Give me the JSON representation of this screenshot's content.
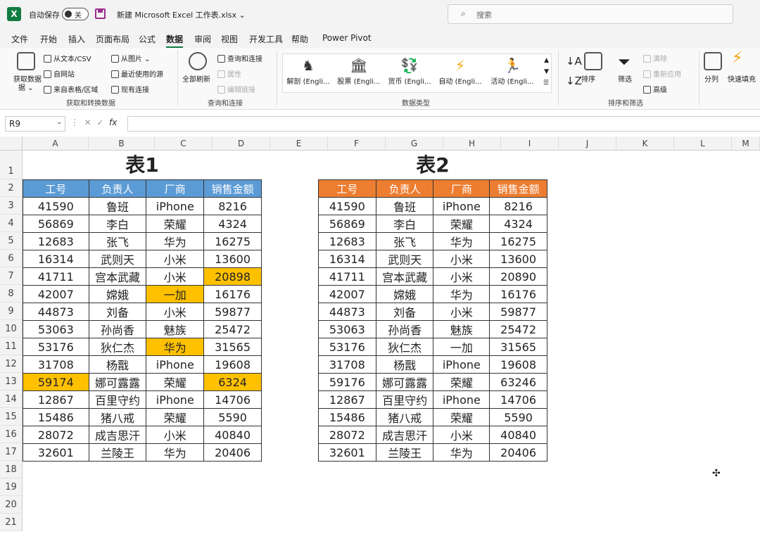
{
  "titlebar": {
    "autosave_label": "自动保存",
    "autosave_state": "关",
    "filename": "新建 Microsoft Excel 工作表.xlsx ⌄",
    "search_placeholder": "搜索"
  },
  "menu": [
    "文件",
    "开始",
    "插入",
    "页面布局",
    "公式",
    "数据",
    "审阅",
    "视图",
    "开发工具",
    "帮助",
    "Power Pivot"
  ],
  "menu_active": "数据",
  "ribbon": {
    "get_data": "获取数据",
    "get_data_sub": "据 ⌄",
    "from_text_csv": "从文本/CSV",
    "from_web": "自网站",
    "from_table": "来自表格/区域",
    "from_picture": "从图片 ⌄",
    "recent_sources": "最近使用的源",
    "existing_conn": "现有连接",
    "group_get_transform": "获取和转换数据",
    "refresh_all": "全部刷新",
    "queries_conn": "查询和连接",
    "properties": "属性",
    "edit_links": "编辑链接",
    "group_queries": "查询和连接",
    "data_types": [
      {
        "label": "解剖 (Engli...",
        "icon": "anatomy-icon"
      },
      {
        "label": "股票 (Engli...",
        "icon": "stocks-icon"
      },
      {
        "label": "货币 (Engli...",
        "icon": "currency-icon"
      },
      {
        "label": "自动 (Engli...",
        "icon": "bolt-icon"
      },
      {
        "label": "活动 (Engli...",
        "icon": "activity-icon"
      }
    ],
    "group_data_types": "数据类型",
    "sort": "排序",
    "filter": "筛选",
    "clear": "清除",
    "reapply": "重新应用",
    "advanced": "高级",
    "group_sort_filter": "排序和筛选",
    "split": "分列",
    "flash_fill": "快速填充"
  },
  "formula_bar": {
    "name_box": "R9",
    "fx": "fx",
    "content": ""
  },
  "columns": [
    "A",
    "B",
    "C",
    "D",
    "E",
    "F",
    "G",
    "H",
    "I",
    "J",
    "K",
    "L",
    "M"
  ],
  "rows": [
    "1",
    "2",
    "3",
    "4",
    "5",
    "6",
    "7",
    "8",
    "9",
    "10",
    "11",
    "12",
    "13",
    "14",
    "15",
    "16",
    "17",
    "18",
    "19",
    "20",
    "21"
  ],
  "table1": {
    "title": "表1",
    "header": [
      "工号",
      "负责人",
      "厂商",
      "销售金额"
    ],
    "rows": [
      [
        "41590",
        "鲁班",
        "iPhone",
        "8216"
      ],
      [
        "56869",
        "李白",
        "荣耀",
        "4324"
      ],
      [
        "12683",
        "张飞",
        "华为",
        "16275"
      ],
      [
        "16314",
        "武则天",
        "小米",
        "13600"
      ],
      [
        "41711",
        "宫本武藏",
        "小米",
        "20898"
      ],
      [
        "42007",
        "嫦娥",
        "一加",
        "16176"
      ],
      [
        "44873",
        "刘备",
        "小米",
        "59877"
      ],
      [
        "53063",
        "孙尚香",
        "魅族",
        "25472"
      ],
      [
        "53176",
        "狄仁杰",
        "华为",
        "31565"
      ],
      [
        "31708",
        "杨戬",
        "iPhone",
        "19608"
      ],
      [
        "59174",
        "娜可露露",
        "荣耀",
        "6324"
      ],
      [
        "12867",
        "百里守约",
        "iPhone",
        "14706"
      ],
      [
        "15486",
        "猪八戒",
        "荣耀",
        "5590"
      ],
      [
        "28072",
        "成吉思汗",
        "小米",
        "40840"
      ],
      [
        "32601",
        "兰陵王",
        "华为",
        "20406"
      ]
    ],
    "highlight_color": "#ffc000",
    "highlights": [
      [
        4,
        3
      ],
      [
        5,
        2
      ],
      [
        8,
        2
      ],
      [
        10,
        0
      ],
      [
        10,
        3
      ]
    ]
  },
  "table2": {
    "title": "表2",
    "header": [
      "工号",
      "负责人",
      "厂商",
      "销售金额"
    ],
    "rows": [
      [
        "41590",
        "鲁班",
        "iPhone",
        "8216"
      ],
      [
        "56869",
        "李白",
        "荣耀",
        "4324"
      ],
      [
        "12683",
        "张飞",
        "华为",
        "16275"
      ],
      [
        "16314",
        "武则天",
        "小米",
        "13600"
      ],
      [
        "41711",
        "宫本武藏",
        "小米",
        "20890"
      ],
      [
        "42007",
        "嫦娥",
        "华为",
        "16176"
      ],
      [
        "44873",
        "刘备",
        "小米",
        "59877"
      ],
      [
        "53063",
        "孙尚香",
        "魅族",
        "25472"
      ],
      [
        "53176",
        "狄仁杰",
        "一加",
        "31565"
      ],
      [
        "31708",
        "杨戬",
        "iPhone",
        "19608"
      ],
      [
        "59176",
        "娜可露露",
        "荣耀",
        "63246"
      ],
      [
        "12867",
        "百里守约",
        "iPhone",
        "14706"
      ],
      [
        "15486",
        "猪八戒",
        "荣耀",
        "5590"
      ],
      [
        "28072",
        "成吉思汗",
        "小米",
        "40840"
      ],
      [
        "32601",
        "兰陵王",
        "华为",
        "20406"
      ]
    ]
  },
  "colors": {
    "table1_header": "#5b9bd5",
    "table2_header": "#ed7d31",
    "accent": "#107c41"
  }
}
